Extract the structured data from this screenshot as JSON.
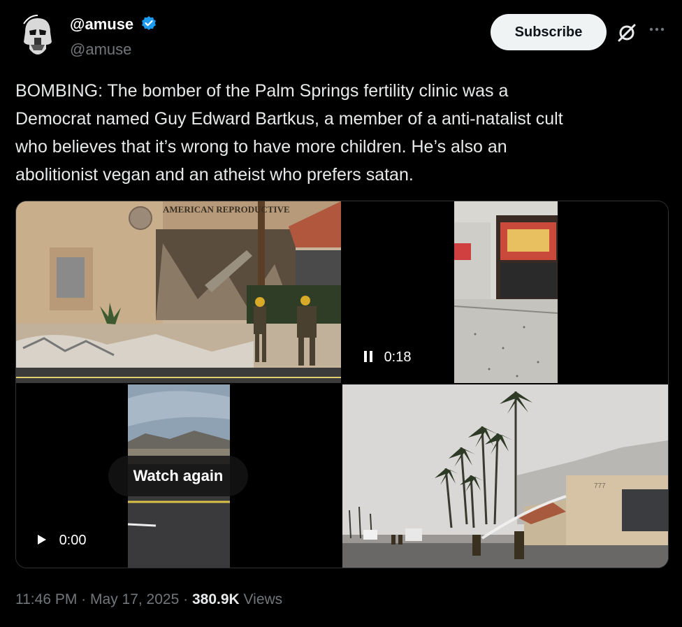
{
  "author": {
    "display_name": "@amuse",
    "handle": "@amuse",
    "verified_icon": "verified-badge-icon",
    "avatar_icon": "stormtrooper-avatar"
  },
  "actions": {
    "subscribe_label": "Subscribe",
    "grok_icon": "grok-icon",
    "more_icon": "more-icon"
  },
  "tweet": {
    "text": "BOMBING: The bomber of the Palm Springs fertility clinic was a\nDemocrat named Guy Edward Bartkus, a member of a anti-natalist cult\nwho believes that it’s wrong to have more children. He’s also an\nabolitionist vegan and an atheist who prefers satan."
  },
  "media": {
    "photo1_sign": "AMERICAN REPRODUCTIVE",
    "video1": {
      "state_icon": "pause-icon",
      "time": "0:18"
    },
    "video2": {
      "state_icon": "play-icon",
      "time": "0:00",
      "overlay": "Watch again"
    },
    "photo2_building_number": "777"
  },
  "footer": {
    "time": "11:46 PM",
    "date": "May 17, 2025",
    "sep": "·",
    "views_count": "380.9K",
    "views_label": "Views"
  },
  "colors": {
    "background": "#000000",
    "text": "#e7e9ea",
    "muted": "#71767b",
    "verified": "#1d9bf0",
    "border": "#2f3336"
  }
}
